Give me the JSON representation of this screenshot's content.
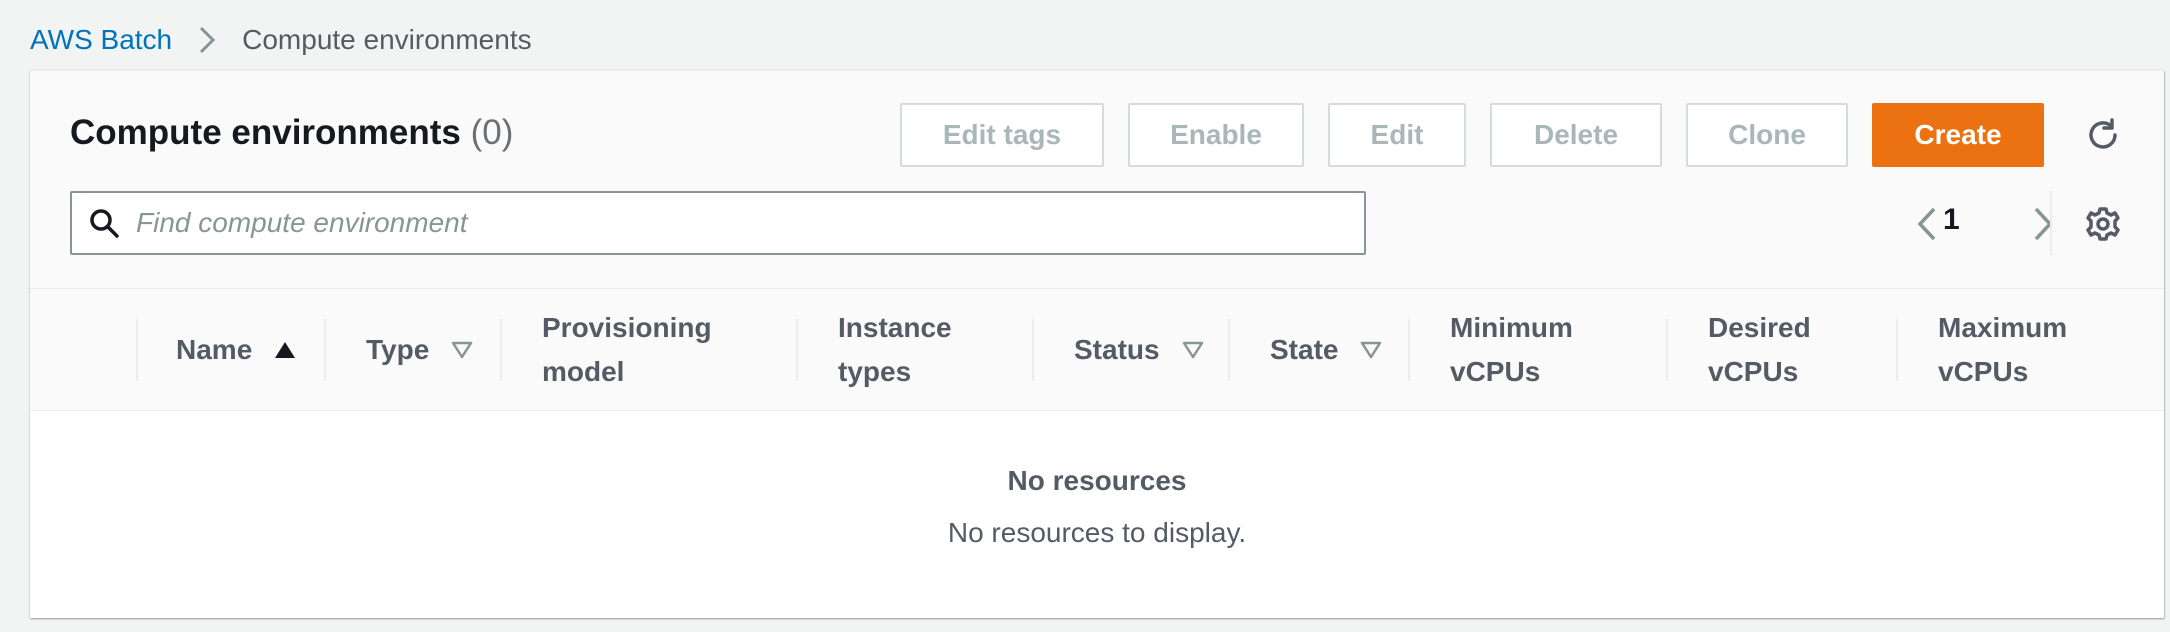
{
  "breadcrumb": {
    "root": "AWS Batch",
    "current": "Compute environments"
  },
  "panel": {
    "title": "Compute environments",
    "count": "(0)"
  },
  "toolbar": {
    "edit_tags": "Edit tags",
    "enable": "Enable",
    "edit": "Edit",
    "delete": "Delete",
    "clone": "Clone",
    "create": "Create"
  },
  "search": {
    "placeholder": "Find compute environment",
    "value": ""
  },
  "pagination": {
    "current_page": "1"
  },
  "table": {
    "columns": [
      {
        "line1": "Name",
        "line2": "",
        "sort": "ascending"
      },
      {
        "line1": "Type",
        "line2": "",
        "sort": "filter"
      },
      {
        "line1": "Provisioning",
        "line2": "model",
        "sort": "none"
      },
      {
        "line1": "Instance",
        "line2": "types",
        "sort": "none"
      },
      {
        "line1": "Status",
        "line2": "",
        "sort": "filter"
      },
      {
        "line1": "State",
        "line2": "",
        "sort": "filter"
      },
      {
        "line1": "Minimum",
        "line2": "vCPUs",
        "sort": "none"
      },
      {
        "line1": "Desired",
        "line2": "vCPUs",
        "sort": "none"
      },
      {
        "line1": "Maximum",
        "line2": "vCPUs",
        "sort": "none"
      }
    ],
    "empty_title": "No resources",
    "empty_text": "No resources to display."
  },
  "icons": {
    "refresh": "refresh-icon",
    "settings": "gear-icon",
    "search": "search-icon",
    "prev": "chevron-left-icon",
    "next": "chevron-right-icon",
    "breadcrumb_sep": "chevron-right-icon"
  },
  "colors": {
    "primary": "#ec7211",
    "link": "#0073bb",
    "disabled_text": "#aab7b8"
  }
}
